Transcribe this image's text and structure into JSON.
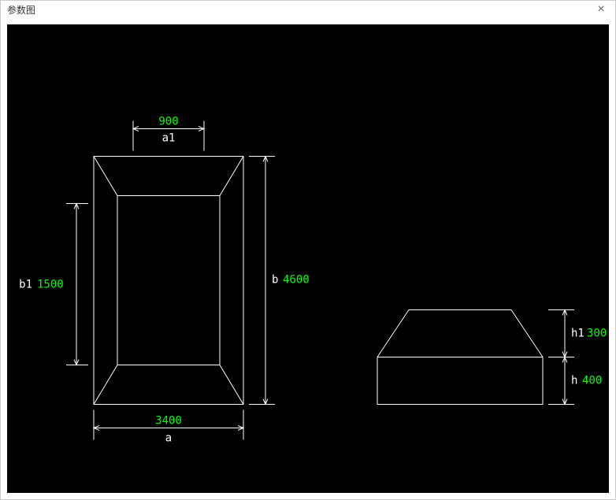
{
  "window": {
    "title": "参数图"
  },
  "dims": {
    "a": {
      "label": "a",
      "value": "3400"
    },
    "a1": {
      "label": "a1",
      "value": "900"
    },
    "b": {
      "label": "b",
      "value": "4600"
    },
    "b1": {
      "label": "b1",
      "value": "1500"
    },
    "h": {
      "label": "h",
      "value": "400"
    },
    "h1": {
      "label": "h1",
      "value": "300"
    }
  }
}
